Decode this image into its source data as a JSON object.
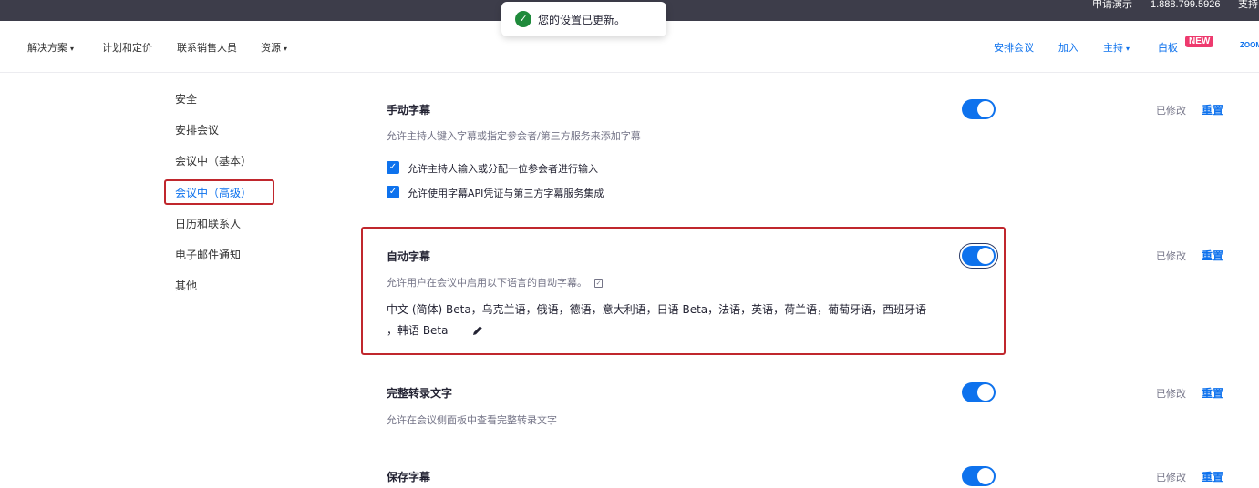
{
  "topbar": {
    "demo_link": "申请演示",
    "phone": "1.888.799.5926",
    "support": "支持"
  },
  "nav": {
    "left_items": [
      {
        "label": "解决方案",
        "has_caret": true
      },
      {
        "label": "计划和定价",
        "has_caret": false
      },
      {
        "label": "联系销售人员",
        "has_caret": false
      },
      {
        "label": "资源",
        "has_caret": true
      }
    ],
    "right_items": [
      {
        "label": "安排会议"
      },
      {
        "label": "加入"
      },
      {
        "label": "主持",
        "has_caret": true
      },
      {
        "label": "白板"
      }
    ],
    "new_badge": "NEW",
    "logo_text": "ZOOM"
  },
  "toast": {
    "message": "您的设置已更新。",
    "icon": "check-circle-icon",
    "color": "#1f8a3b"
  },
  "sidebar": {
    "items": [
      {
        "label": "安全",
        "active": false
      },
      {
        "label": "安排会议",
        "active": false
      },
      {
        "label": "会议中（基本）",
        "active": false
      },
      {
        "label": "会议中（高级）",
        "active": true
      },
      {
        "label": "日历和联系人",
        "active": false
      },
      {
        "label": "电子邮件通知",
        "active": false
      },
      {
        "label": "其他",
        "active": false
      }
    ]
  },
  "settings": [
    {
      "title": "手动字幕",
      "description": "允许主持人键入字幕或指定参会者/第三方服务来添加字幕",
      "enabled": true,
      "status": "已修改",
      "reset_label": "重置",
      "options": [
        {
          "label": "允许主持人输入或分配一位参会者进行输入",
          "checked": true
        },
        {
          "label": "允许使用字幕API凭证与第三方字幕服务集成",
          "checked": true
        }
      ]
    },
    {
      "title": "自动字幕",
      "description": "允许用户在会议中启用以下语言的自动字幕。",
      "enabled": true,
      "status": "已修改",
      "reset_label": "重置",
      "languages_line1": "中文 (简体)  Beta，乌克兰语，俄语，德语，意大利语，日语  Beta，法语，英语，荷兰语，葡萄牙语，西班牙语",
      "languages_line2": "，韩语  Beta"
    },
    {
      "title": "完整转录文字",
      "description": "允许在会议侧面板中查看完整转录文字",
      "enabled": true,
      "status": "已修改",
      "reset_label": "重置"
    },
    {
      "title": "保存字幕",
      "enabled": true,
      "status": "已修改",
      "reset_label": "重置"
    }
  ],
  "colors": {
    "accent": "#0e72ed",
    "highlight": "#c0272d",
    "topbar": "#3d3d4a"
  }
}
